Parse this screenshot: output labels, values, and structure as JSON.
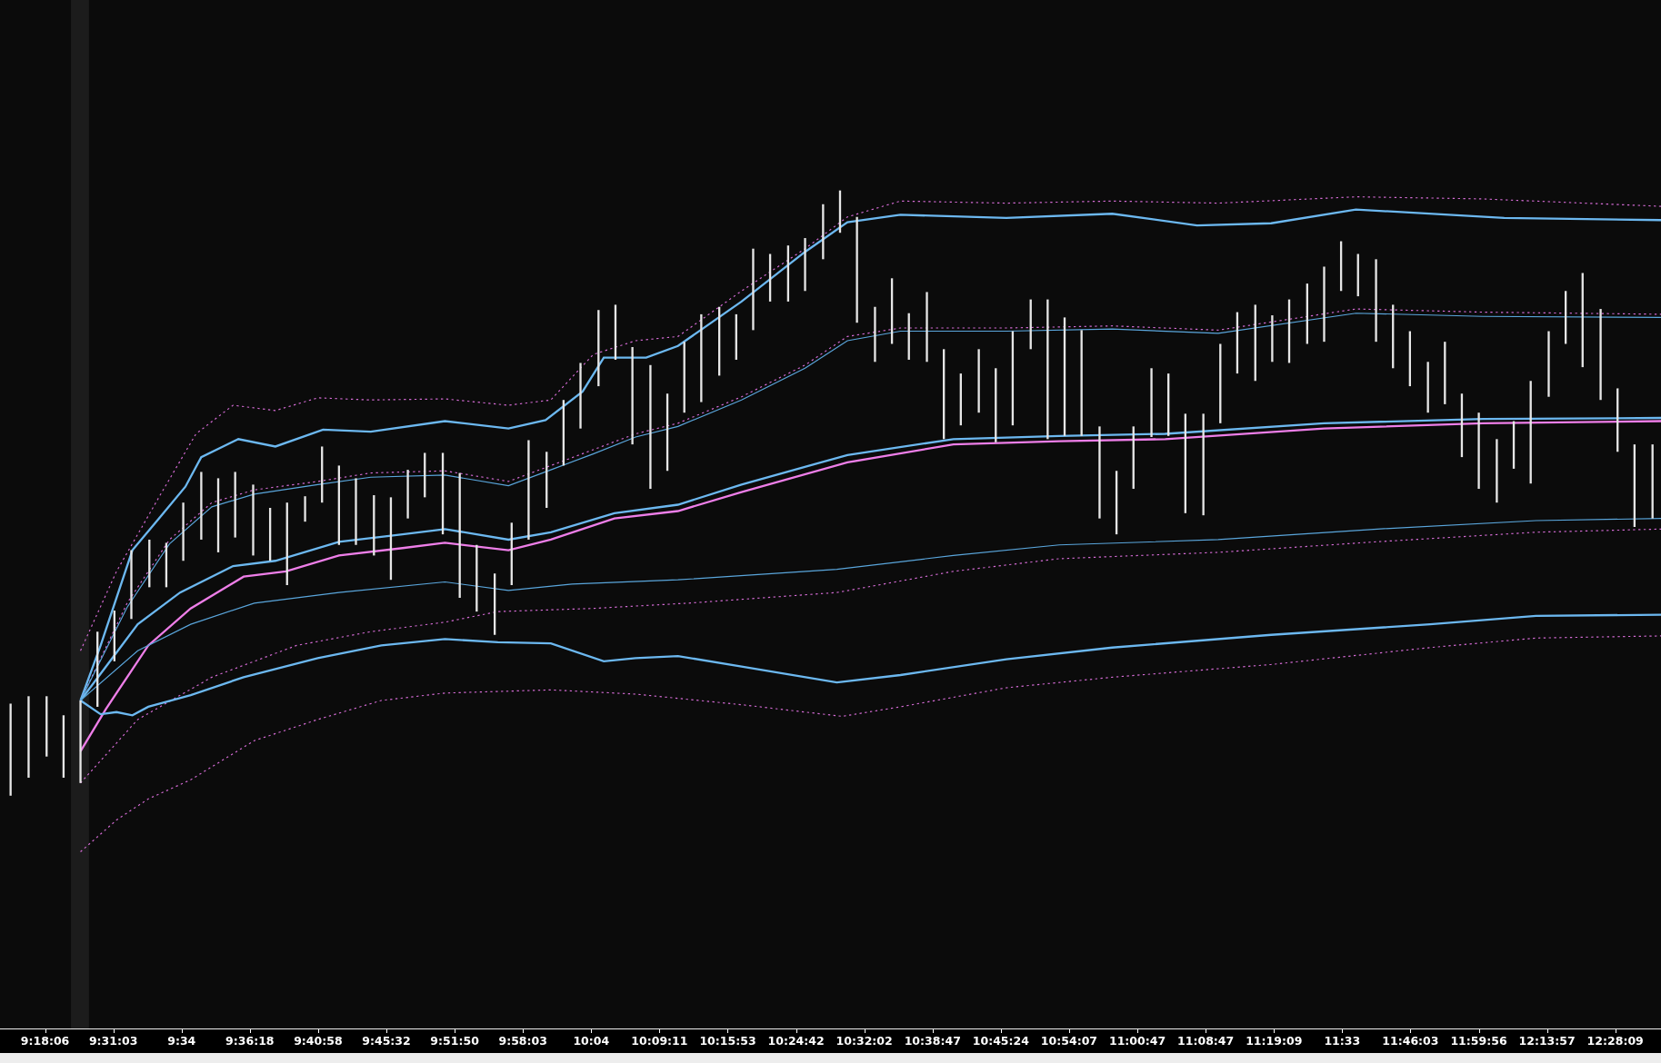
{
  "time_axis": {
    "labels": [
      "9:18:06",
      "9:31:03",
      "9:34",
      "9:36:18",
      "9:40:58",
      "9:45:32",
      "9:51:50",
      "9:58:03",
      "10:04",
      "10:09:11",
      "10:15:53",
      "10:24:42",
      "10:32:02",
      "10:38:47",
      "10:45:24",
      "10:54:07",
      "11:00:47",
      "11:08:47",
      "11:19:09",
      "11:33",
      "11:46:03",
      "11:59:56",
      "12:13:57",
      "12:28:09"
    ]
  }
}
